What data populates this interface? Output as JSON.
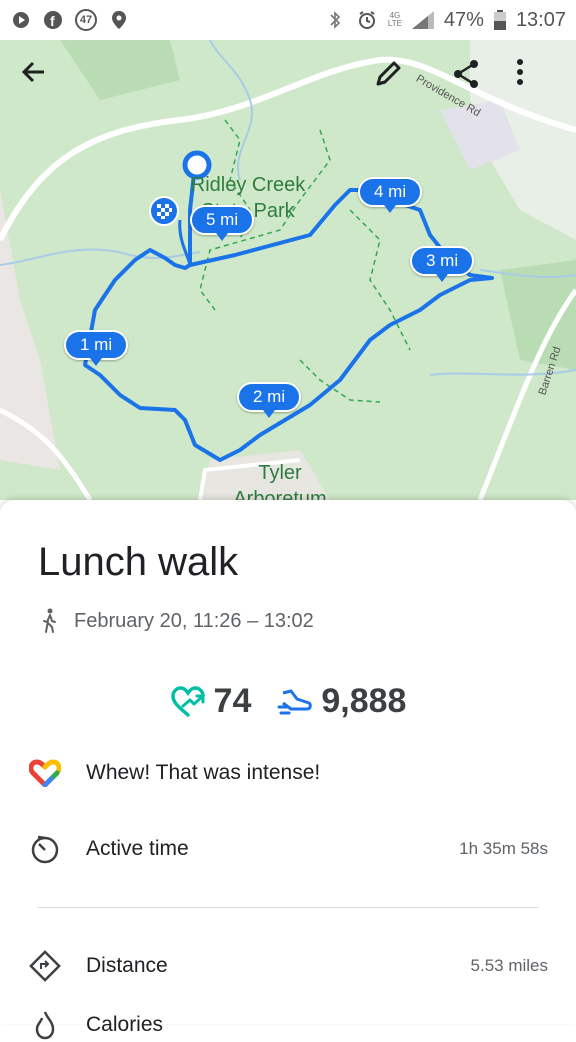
{
  "status_bar": {
    "left_icons": [
      "play-circle-icon",
      "facebook-icon",
      "notification-count-icon",
      "location-pin-icon"
    ],
    "notification_count": "47",
    "right_icons": [
      "bluetooth-icon",
      "alarm-icon",
      "lte-icon",
      "signal-icon",
      "battery-icon"
    ],
    "lte": "4G LTE",
    "battery": "47%",
    "time": "13:07"
  },
  "map": {
    "labels": {
      "park_line1": "Ridley Creek",
      "park_line2": "State Park",
      "arboretum_line1": "Tyler",
      "arboretum_line2": "Arboretum"
    },
    "roads": {
      "providence": "Providence Rd",
      "barren": "Barren Rd"
    },
    "mile_markers": [
      "1 mi",
      "2 mi",
      "3 mi",
      "4 mi",
      "5 mi"
    ],
    "buttons": [
      "back-arrow-icon",
      "edit-pencil-icon",
      "share-icon",
      "more-vert-icon"
    ],
    "colors": {
      "route": "#1a73e8",
      "land": "#cfe8c9",
      "trail": "#34a853"
    }
  },
  "sheet": {
    "title": "Lunch walk",
    "subtitle": "February 20, 11:26 – 13:02",
    "heart_points": "74",
    "steps": "9,888",
    "message": "Whew! That was intense!",
    "rows": [
      {
        "label": "Active time",
        "value": "1h 35m 58s",
        "icon": "timer-icon"
      },
      {
        "label": "Distance",
        "value": "5.53 miles",
        "icon": "route-diamond-icon"
      },
      {
        "label": "Calories",
        "icon": "flame-icon"
      }
    ]
  }
}
